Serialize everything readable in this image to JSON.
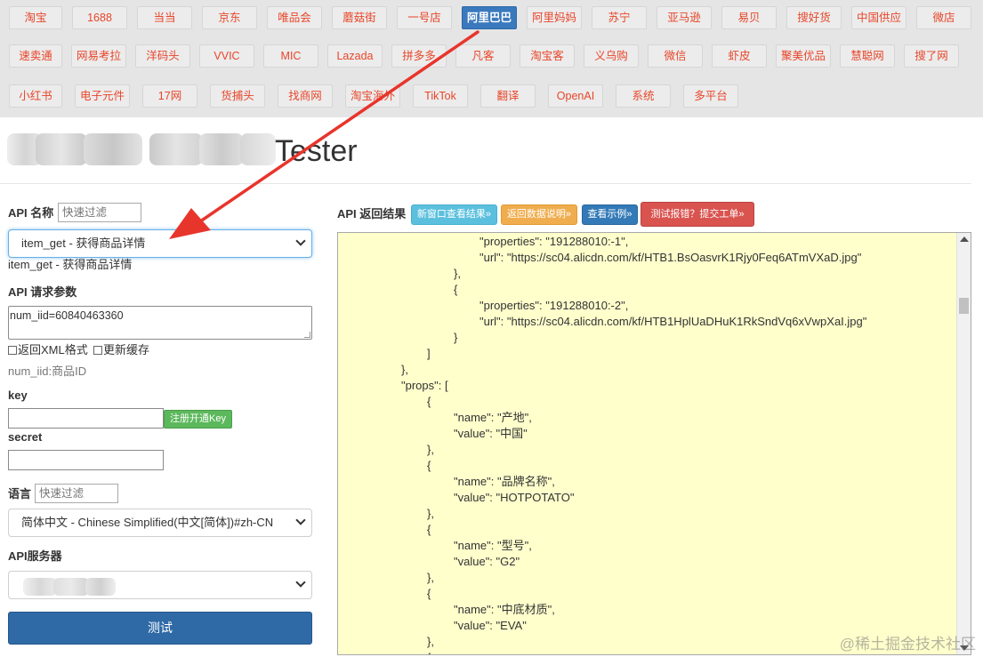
{
  "platforms": [
    [
      "淘宝",
      "1688",
      "当当",
      "京东",
      "唯品会",
      "蘑菇街",
      "一号店",
      "阿里巴巴",
      "阿里妈妈",
      "苏宁",
      "亚马逊",
      "易贝",
      "搜好货",
      "中国供应",
      "微店"
    ],
    [
      "速卖通",
      "网易考拉",
      "洋码头",
      "VVIC",
      "MIC",
      "Lazada",
      "拼多多",
      "凡客",
      "淘宝客",
      "义乌购",
      "微信",
      "虾皮",
      "聚美优品",
      "慧聪网",
      "搜了网"
    ],
    [
      "小红书",
      "电子元件",
      "17网",
      "货捕头",
      "找商网",
      "淘宝海外",
      "TikTok",
      "翻译",
      "OpenAI",
      "系统",
      "多平台"
    ]
  ],
  "active_platform": "阿里巴巴",
  "title": "Tester",
  "left": {
    "api_name_label": "API 名称",
    "filter_placeholder": "快速过滤",
    "api_select_value": "item_get - 获得商品详情",
    "api_description": "item_get - 获得商品详情",
    "params_label": "API 请求参数",
    "params_value": "num_iid=60840463360",
    "xml_checkbox_label": "返回XML格式",
    "cache_checkbox_label": "更新缓存",
    "param_hint": "num_iid:商品ID",
    "key_label": "key",
    "register_button": "注册开通Key",
    "secret_label": "secret",
    "lang_label": "语言",
    "lang_value": "简体中文 - Chinese Simplified(中文[简体])#zh-CN",
    "server_label": "API服务器",
    "test_button": "测试"
  },
  "right": {
    "result_label": "API 返回结果",
    "buttons": [
      "新窗口查看结果»",
      "返回数据说明»",
      "查看示例»",
      "测试报错？提交工单»"
    ],
    "json_lines": [
      "\"properties\": \"191288010:-1\",",
      "\"url\": \"https://sc04.alicdn.com/kf/HTB1.BsOasvrK1Rjy0Feq6ATmVXaD.jpg\"",
      "},",
      "{",
      "\"properties\": \"191288010:-2\",",
      "\"url\": \"https://sc04.alicdn.com/kf/HTB1HplUaDHuK1RkSndVq6xVwpXaI.jpg\"",
      "}",
      "]",
      "},",
      "\"props\": [",
      "{",
      "\"name\": \"产地\",",
      "\"value\": \"中国\"",
      "},",
      "{",
      "\"name\": \"品牌名称\",",
      "\"value\": \"HOTPOTATO\"",
      "},",
      "{",
      "\"name\": \"型号\",",
      "\"value\": \"G2\"",
      "},",
      "{",
      "\"name\": \"中底材质\",",
      "\"value\": \"EVA\"",
      "},",
      "{"
    ]
  },
  "watermark": "@稀土掘金技术社区",
  "colors": {
    "platform_text": "#e8462a",
    "active_platform_bg": "#3a79bd",
    "result_bg": "#ffffcc",
    "arrow": "#e8352c",
    "button_new_window": "#5bc0de",
    "button_data_doc": "#f0ad4e",
    "button_example": "#337ab7",
    "button_report": "#d9534f",
    "register_button": "#5cb85c",
    "test_button": "#2f6aa6"
  }
}
